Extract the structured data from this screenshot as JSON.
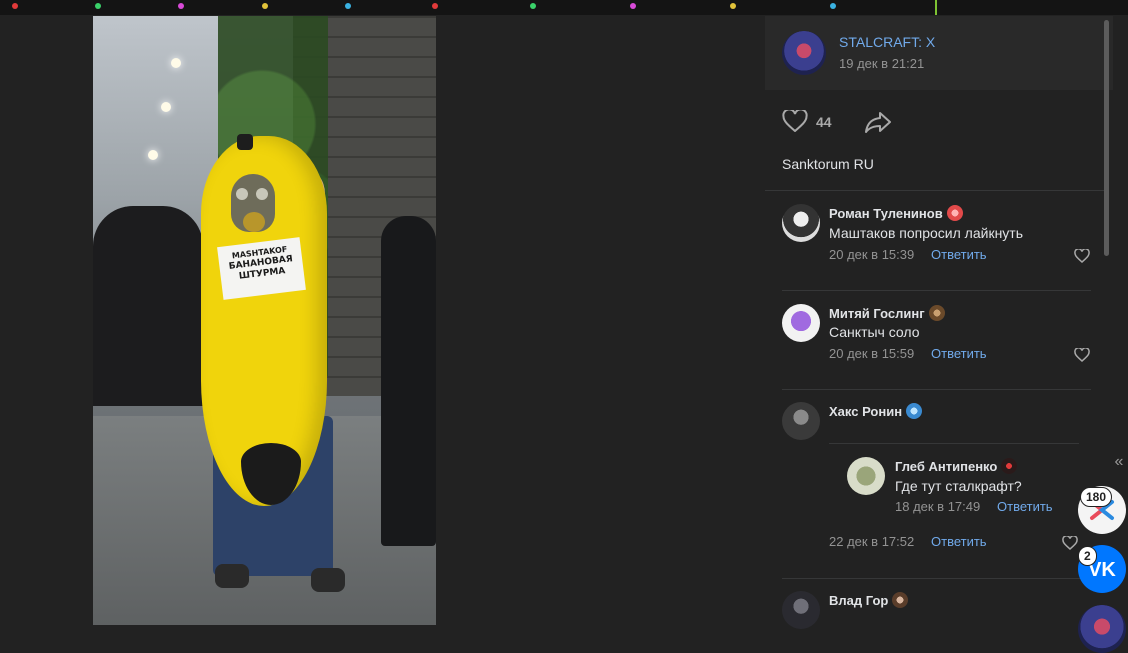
{
  "post": {
    "group_name": "STALCRAFT: X",
    "date": "19 дек в 21:21",
    "likes": "44",
    "author": "Sanktorum RU",
    "photo": {
      "sign_line1": "MASHTAKOF",
      "sign_line2": "БАНАНОВАЯ",
      "sign_line3": "ШТУРМА"
    }
  },
  "comments": [
    {
      "name": "Роман Туленинов",
      "text": "Маштаков попросил лайкнуть",
      "date": "20 дек в 15:39",
      "reply_label": "Ответить"
    },
    {
      "name": "Митяй Гослинг",
      "text": "Санктыч соло",
      "date": "20 дек в 15:59",
      "reply_label": "Ответить"
    },
    {
      "name": "Хакс Ронин",
      "date": "22 дек в 17:52",
      "reply_label": "Ответить",
      "reply": {
        "name": "Глеб Антипенко",
        "text": "Где тут сталкрафт?",
        "date": "18 дек в 17:49",
        "reply_label": "Ответить"
      }
    },
    {
      "name": "Влад Гор"
    }
  ],
  "sidebar": {
    "app_badge": "180",
    "vk_badge": "2"
  },
  "colors": {
    "background": "#222222",
    "link": "#71aaeb",
    "muted": "#939393",
    "vk_blue": "#0077ff"
  },
  "icons": [
    "heart-icon",
    "share-icon",
    "collapse-icon",
    "vk-icon",
    "app-icon"
  ]
}
